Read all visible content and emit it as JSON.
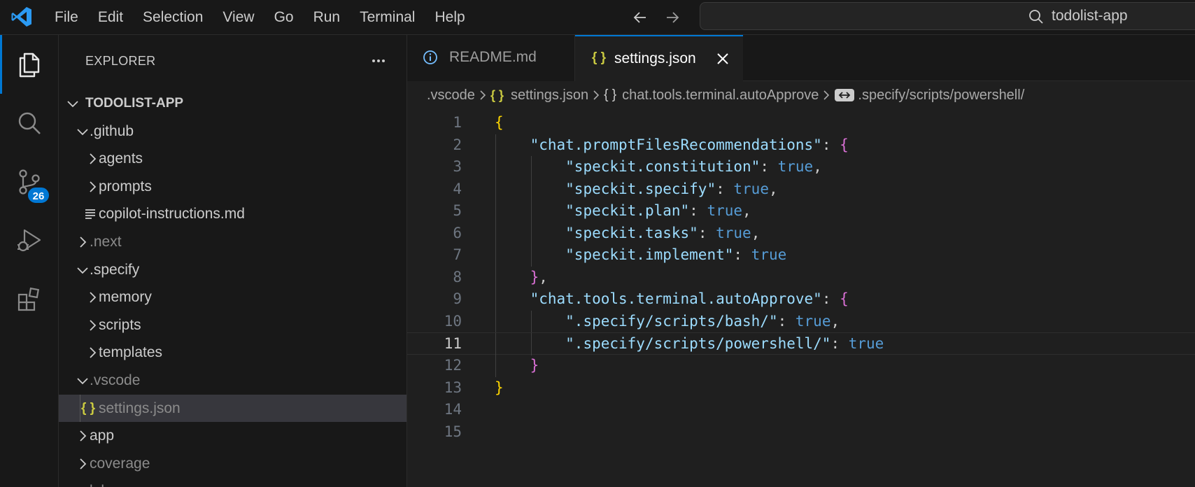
{
  "window": {
    "menu": [
      "File",
      "Edit",
      "Selection",
      "View",
      "Go",
      "Run",
      "Terminal",
      "Help"
    ],
    "search_text": "todolist-app"
  },
  "activity_bar": {
    "items": [
      "explorer-icon",
      "search-icon",
      "source-control-icon",
      "run-debug-icon",
      "extensions-icon"
    ],
    "source_control_badge": "26"
  },
  "sidebar": {
    "title": "EXPLORER",
    "root": "TODOLIST-APP",
    "tree": [
      {
        "label": ".github",
        "depth": 1,
        "type": "folder",
        "expanded": true
      },
      {
        "label": "agents",
        "depth": 2,
        "type": "folder",
        "expanded": false
      },
      {
        "label": "prompts",
        "depth": 2,
        "type": "folder",
        "expanded": false
      },
      {
        "label": "copilot-instructions.md",
        "depth": 2,
        "type": "file-md"
      },
      {
        "label": ".next",
        "depth": 1,
        "type": "folder",
        "expanded": false,
        "dim": true
      },
      {
        "label": ".specify",
        "depth": 1,
        "type": "folder",
        "expanded": true
      },
      {
        "label": "memory",
        "depth": 2,
        "type": "folder",
        "expanded": false
      },
      {
        "label": "scripts",
        "depth": 2,
        "type": "folder",
        "expanded": false
      },
      {
        "label": "templates",
        "depth": 2,
        "type": "folder",
        "expanded": false
      },
      {
        "label": ".vscode",
        "depth": 1,
        "type": "folder",
        "expanded": true,
        "dim": true
      },
      {
        "label": "settings.json",
        "depth": 2,
        "type": "file-json",
        "selected": true,
        "dim": true
      },
      {
        "label": "app",
        "depth": 1,
        "type": "folder",
        "expanded": false
      },
      {
        "label": "coverage",
        "depth": 1,
        "type": "folder",
        "expanded": false,
        "dim": true
      },
      {
        "label": "labs",
        "depth": 1,
        "type": "folder",
        "expanded": true,
        "dim": true
      }
    ]
  },
  "tabs": [
    {
      "label": "README.md",
      "icon": "info-icon",
      "active": false
    },
    {
      "label": "settings.json",
      "icon": "json-icon",
      "active": true
    }
  ],
  "breadcrumb": [
    ".vscode",
    "settings.json",
    "chat.tools.terminal.autoApprove",
    ".specify/scripts/powershell/"
  ],
  "editor": {
    "current_line": 11,
    "lines": [
      {
        "n": "1",
        "tokens": [
          [
            "br1",
            "{"
          ]
        ]
      },
      {
        "n": "2",
        "tokens": [
          [
            "p",
            "    "
          ],
          [
            "k",
            "\"chat.promptFilesRecommendations\""
          ],
          [
            "p",
            ": "
          ],
          [
            "br2",
            "{"
          ]
        ]
      },
      {
        "n": "3",
        "tokens": [
          [
            "p",
            "        "
          ],
          [
            "k",
            "\"speckit.constitution\""
          ],
          [
            "p",
            ": "
          ],
          [
            "b",
            "true"
          ],
          [
            "p",
            ","
          ]
        ]
      },
      {
        "n": "4",
        "tokens": [
          [
            "p",
            "        "
          ],
          [
            "k",
            "\"speckit.specify\""
          ],
          [
            "p",
            ": "
          ],
          [
            "b",
            "true"
          ],
          [
            "p",
            ","
          ]
        ]
      },
      {
        "n": "5",
        "tokens": [
          [
            "p",
            "        "
          ],
          [
            "k",
            "\"speckit.plan\""
          ],
          [
            "p",
            ": "
          ],
          [
            "b",
            "true"
          ],
          [
            "p",
            ","
          ]
        ]
      },
      {
        "n": "6",
        "tokens": [
          [
            "p",
            "        "
          ],
          [
            "k",
            "\"speckit.tasks\""
          ],
          [
            "p",
            ": "
          ],
          [
            "b",
            "true"
          ],
          [
            "p",
            ","
          ]
        ]
      },
      {
        "n": "7",
        "tokens": [
          [
            "p",
            "        "
          ],
          [
            "k",
            "\"speckit.implement\""
          ],
          [
            "p",
            ": "
          ],
          [
            "b",
            "true"
          ]
        ]
      },
      {
        "n": "8",
        "tokens": [
          [
            "p",
            "    "
          ],
          [
            "br2",
            "}"
          ],
          [
            "p",
            ","
          ]
        ]
      },
      {
        "n": "9",
        "tokens": [
          [
            "p",
            "    "
          ],
          [
            "k",
            "\"chat.tools.terminal.autoApprove\""
          ],
          [
            "p",
            ": "
          ],
          [
            "br2",
            "{"
          ]
        ]
      },
      {
        "n": "10",
        "tokens": [
          [
            "p",
            "        "
          ],
          [
            "k",
            "\".specify/scripts/bash/\""
          ],
          [
            "p",
            ": "
          ],
          [
            "b",
            "true"
          ],
          [
            "p",
            ","
          ]
        ]
      },
      {
        "n": "11",
        "tokens": [
          [
            "p",
            "        "
          ],
          [
            "k",
            "\".specify/scripts/powershell/\""
          ],
          [
            "p",
            ": "
          ],
          [
            "b",
            "true"
          ]
        ]
      },
      {
        "n": "12",
        "tokens": [
          [
            "p",
            "    "
          ],
          [
            "br2",
            "}"
          ]
        ]
      },
      {
        "n": "13",
        "tokens": [
          [
            "br1",
            "}"
          ]
        ]
      },
      {
        "n": "14",
        "tokens": []
      },
      {
        "n": "15",
        "tokens": []
      }
    ]
  },
  "colors": {
    "accent": "#0078d4",
    "key": "#9cdcfe",
    "boolean": "#569cd6",
    "bracket_level1": "#ffd700",
    "bracket_level2": "#da70d6",
    "json_icon": "#cbcb41"
  }
}
